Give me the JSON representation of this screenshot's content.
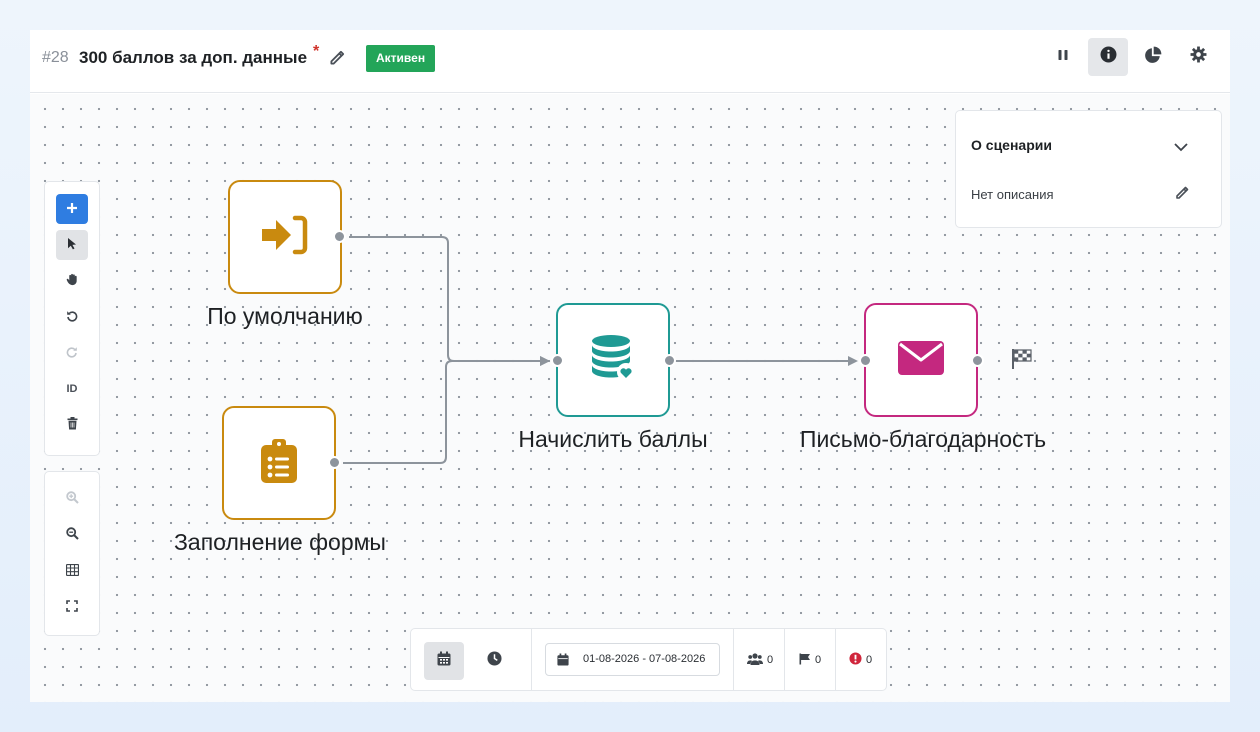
{
  "header": {
    "scenario_id": "#28",
    "title": "300 баллов за доп. данные",
    "required_mark": "*",
    "status": "Активен",
    "icons": [
      "pencil-icon",
      "pause-icon",
      "info-circle-icon",
      "pie-chart-icon",
      "gear-icon"
    ]
  },
  "toolbar": {
    "tools": [
      "plus-icon",
      "cursor-pointer-icon",
      "hand-icon",
      "undo-icon",
      "redo-icon",
      "id-toggle",
      "trash-icon"
    ],
    "id_label": "ID",
    "zoom_tools": [
      "zoom-in-icon",
      "zoom-out-icon",
      "grid-icon",
      "fullscreen-icon"
    ]
  },
  "nodes": [
    {
      "key": "entry",
      "label": "По умолчанию",
      "icon": "sign-in-icon",
      "color": "#c98a0f"
    },
    {
      "key": "form",
      "label": "Заполнение формы",
      "icon": "clipboard-list-icon",
      "color": "#c98a0f"
    },
    {
      "key": "points",
      "label": "Начислить баллы",
      "icon": "database-heart-icon",
      "color": "#1f9a94"
    },
    {
      "key": "email",
      "label": "Письмо-благодарность",
      "icon": "envelope-icon",
      "color": "#c4287f"
    }
  ],
  "finish_icon": "flag-checkered-icon",
  "info_panel": {
    "title": "О сценарии",
    "description": "Нет описания"
  },
  "bottom_bar": {
    "date_range": "01-08-2026 - 07-08-2026",
    "stats": {
      "users": "0",
      "goals": "0",
      "errors": "0"
    }
  },
  "colors": {
    "active_badge": "#23a559",
    "primary": "#2f7de1",
    "error": "#d0263c",
    "edge": "#8d949c"
  }
}
